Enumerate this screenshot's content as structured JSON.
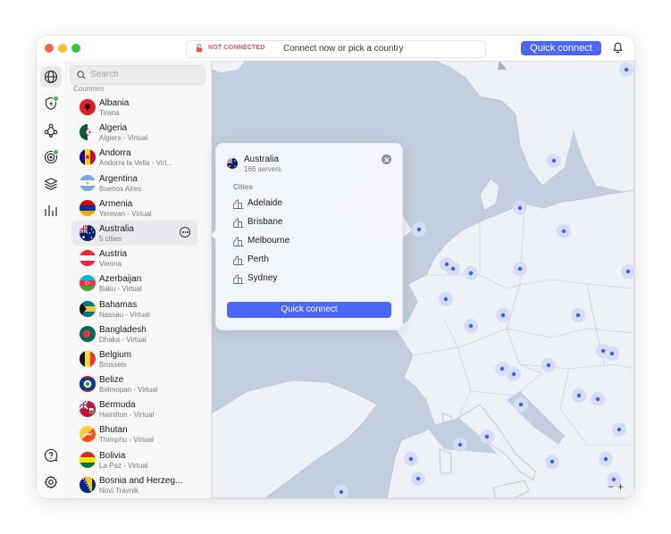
{
  "titlebar": {
    "status": "NOT CONNECTED",
    "message": "Connect now or pick a country",
    "quick_connect": "Quick connect"
  },
  "sidebar": {
    "search_placeholder": "Search",
    "section_title": "Countries",
    "countries": [
      {
        "name": "Albania",
        "sub": "Tirana",
        "flag": "albania"
      },
      {
        "name": "Algeria",
        "sub": "Algiers - Virtual",
        "flag": "algeria"
      },
      {
        "name": "Andorra",
        "sub": "Andorra la Vella - Virt...",
        "flag": "andorra"
      },
      {
        "name": "Argentina",
        "sub": "Buenos Aires",
        "flag": "argentina"
      },
      {
        "name": "Armenia",
        "sub": "Yerevan - Virtual",
        "flag": "armenia"
      },
      {
        "name": "Australia",
        "sub": "5 cities",
        "flag": "australia",
        "selected": true
      },
      {
        "name": "Austria",
        "sub": "Vienna",
        "flag": "austria"
      },
      {
        "name": "Azerbaijan",
        "sub": "Baku - Virtual",
        "flag": "azerbaijan"
      },
      {
        "name": "Bahamas",
        "sub": "Nassau - Virtual",
        "flag": "bahamas"
      },
      {
        "name": "Bangladesh",
        "sub": "Dhaka - Virtual",
        "flag": "bangladesh"
      },
      {
        "name": "Belgium",
        "sub": "Brussels",
        "flag": "belgium"
      },
      {
        "name": "Belize",
        "sub": "Belmopan - Virtual",
        "flag": "belize"
      },
      {
        "name": "Bermuda",
        "sub": "Hamilton - Virtual",
        "flag": "bermuda"
      },
      {
        "name": "Bhutan",
        "sub": "Thimphu - Virtual",
        "flag": "bhutan"
      },
      {
        "name": "Bolivia",
        "sub": "La Paz - Virtual",
        "flag": "bolivia"
      },
      {
        "name": "Bosnia and Herzeg...",
        "sub": "Novi Travnik",
        "flag": "bosnia"
      }
    ]
  },
  "popover": {
    "country": "Australia",
    "servers": "166 servers",
    "cities_title": "Cities",
    "cities": [
      "Adelaide",
      "Brisbane",
      "Melbourne",
      "Perth",
      "Sydney"
    ],
    "quick_connect": "Quick connect"
  },
  "map": {
    "zoom_out": "−",
    "zoom_in": "+"
  },
  "colors": {
    "accent": "#4c67f6",
    "status_red": "#e2574c",
    "sea": "#c3cfde",
    "land": "#eef1f6",
    "server_dot": "#3d5cf5"
  },
  "icons": {
    "nav": [
      "globe-icon",
      "shield-icon",
      "meshnet-icon",
      "target-icon",
      "layers-icon",
      "stats-icon"
    ],
    "bottom": [
      "help-icon",
      "settings-icon"
    ]
  }
}
